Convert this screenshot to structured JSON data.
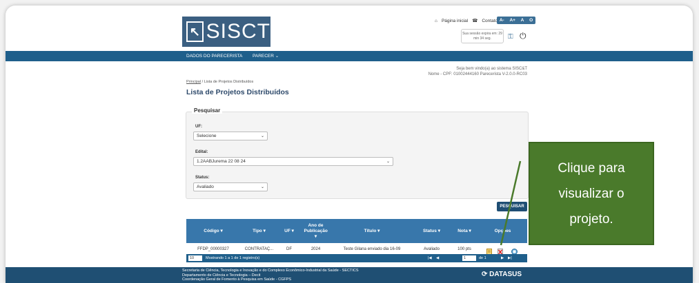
{
  "header": {
    "logo_text": "SISCT",
    "links": {
      "home": "Página inicial",
      "contact": "Contato"
    },
    "font_buttons": [
      "A-",
      "A+",
      "A",
      "O"
    ],
    "session_text": "Sua sessão expira em: 29 min 34 seg."
  },
  "nav": {
    "items": [
      "DADOS DO PARECERISTA",
      "PARECER"
    ]
  },
  "welcome": {
    "line1": "Seja bem vindo(a) ao sistema SISC&T",
    "line2": "Nome - CPF: 01002444160 Parecerista V-2.0.0-RC03"
  },
  "breadcrumb": {
    "home": "Principal",
    "separator": "/",
    "current": "Lista de Projetos Distribuídos"
  },
  "page_title": "Lista de Projetos Distribuídos",
  "filter": {
    "legend": "Pesquisar",
    "uf_label": "UF:",
    "uf_value": "Selecione",
    "edital_label": "Edital:",
    "edital_value": "1.2AABJurema 22 08 24",
    "status_label": "Status:",
    "status_value": "Avaliado",
    "search_button": "PESQUISAR"
  },
  "table": {
    "headers": [
      "Código",
      "Tipo",
      "UF",
      "Ano de Publicação",
      "Título",
      "Status",
      "Nota",
      "Opções"
    ],
    "rows": [
      [
        "FFDP_00000327",
        "CONTRATAÇ...",
        "DF",
        "2024",
        "Teste Gilana enviado dia 16-09",
        "Avaliado",
        "100 pts"
      ]
    ]
  },
  "pager": {
    "page_size": "10",
    "info": "Mostrando 1 a 1 de 1 registro(s)",
    "page": "1",
    "of": "de 1"
  },
  "footer": {
    "line1": "Secretaria de Ciência, Tecnologia e Inovação e do Complexo Econômico-Industrial da Saúde - SECTICS",
    "line2": "Departamento de Ciência e Tecnologia – Decit",
    "line3": "Coordenação Geral de Fomento à Pesquisa em Saúde - CGFPS",
    "brand": "DATASUS"
  },
  "callout": {
    "line1": "Clique para",
    "line2": "visualizar o",
    "line3": "projeto."
  },
  "colors": {
    "nav": "#1f5f8b",
    "table_header": "#3877ab",
    "callout": "#4a7a2b"
  }
}
